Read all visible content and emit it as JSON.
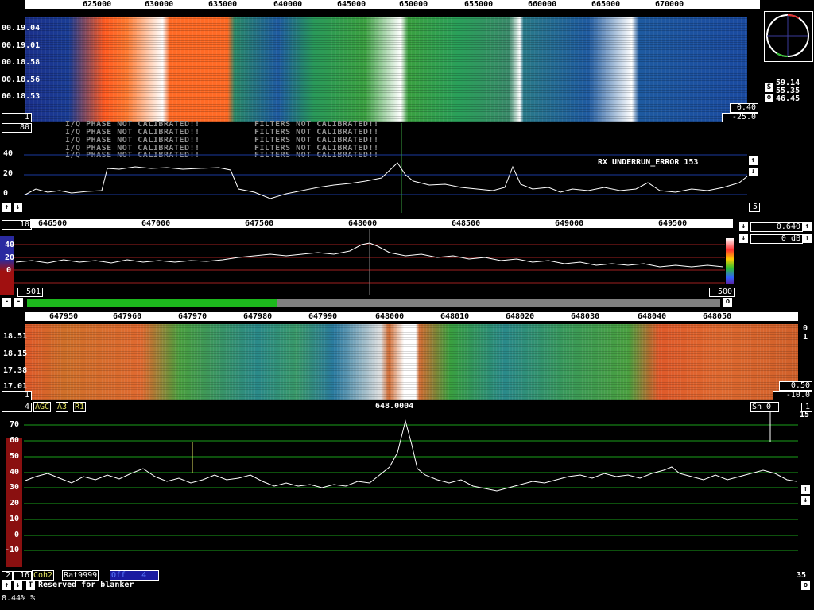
{
  "top_window": {
    "freq_ticks": [
      "625000",
      "630000",
      "635000",
      "640000",
      "645000",
      "650000",
      "655000",
      "660000",
      "665000",
      "670000"
    ],
    "time_labels": [
      "00.19.04",
      "00.19.01",
      "00.18.58",
      "00.18.56",
      "00.18.53"
    ],
    "wf_value_a": "0.40",
    "wf_value_b": "-25.0",
    "wf_left_num": "1",
    "spectrum_left_num": "80",
    "y_labels": [
      "40",
      "20",
      "0"
    ],
    "spectrum_right_num": "5",
    "warnings": [
      "I/Q PHASE NOT CALIBRATED!!",
      "I/Q PHASE NOT CALIBRATED!!",
      "I/Q PHASE NOT CALIBRATED!!",
      "I/Q PHASE NOT CALIBRATED!!",
      "I/Q PHASE NOT CALIBRATED!!"
    ],
    "filter_warnings": [
      "FILTERS NOT CALIBRATED!!",
      "FILTERS NOT CALIBRATED!!",
      "FILTERS NOT CALIBRATED!!",
      "FILTERS NOT CALIBRATED!!",
      "FILTERS NOT CALIBRATED!!"
    ],
    "error_text": "RX UNDERRUN_ERROR 153"
  },
  "side_panel": {
    "s_label": "S",
    "o_label": "o",
    "values": [
      "59.14",
      "55.35",
      "46.45"
    ]
  },
  "mid_window": {
    "left_num": "10",
    "freq_ticks": [
      "646500",
      "647000",
      "647500",
      "648000",
      "648500",
      "649000",
      "649500"
    ],
    "y_labels": [
      "40",
      "20",
      "0"
    ],
    "bottom_left": "501",
    "bottom_right": "500",
    "gain": "0.640",
    "db": "0 dB",
    "progress_fraction": 0.36
  },
  "bottom_window": {
    "freq_ticks": [
      "647950",
      "647960",
      "647970",
      "647980",
      "647990",
      "648000",
      "648010",
      "648020",
      "648030",
      "648040",
      "648050"
    ],
    "time_labels": [
      "18.51",
      "18.15",
      "17.38",
      "17.01"
    ],
    "wf_value_a": "0.50",
    "wf_value_b": "-10.0",
    "wf_left_num": "1",
    "right_nums": [
      "0",
      "1"
    ],
    "status_num": "4",
    "agc": "AGC",
    "a3": "A3",
    "r1": "R1",
    "center_freq": "648.0004",
    "sh": "Sh 0",
    "sh_num": "1",
    "right_top_num": "15",
    "y_labels": [
      "70",
      "60",
      "50",
      "40",
      "30",
      "20",
      "10",
      "0",
      "-10"
    ],
    "footer_num_a": "2",
    "footer_num_b": "16",
    "coh": "Coh2",
    "rat": "Rat9999",
    "off": "Off",
    "off_num": "4",
    "right_bottom_num": "35",
    "blanker": "Reserved for blanker",
    "t_label": "T"
  },
  "status_line": "8.44% %",
  "colors": {
    "accent": "#2bc42b",
    "grid_blue": "#1a3aa0",
    "grid_red": "#a02020",
    "grid_green": "#1aa01a"
  }
}
